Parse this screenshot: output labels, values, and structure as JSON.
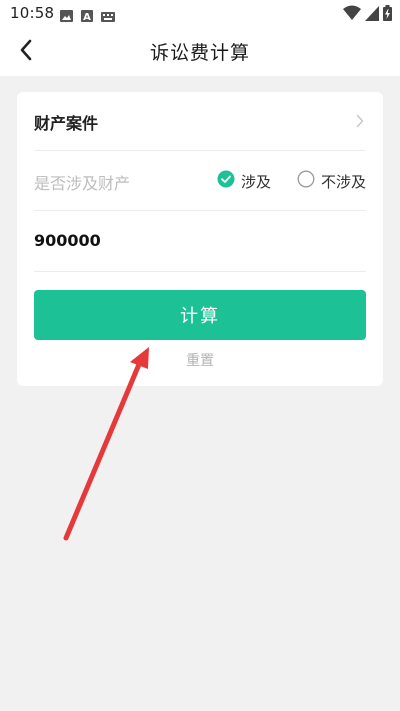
{
  "status_bar": {
    "time": "10:58",
    "left_icons": [
      "image-icon",
      "text-a-icon",
      "keyboard-icon"
    ],
    "right_icons": [
      "wifi-icon",
      "signal-icon",
      "battery-charging-icon"
    ]
  },
  "nav": {
    "back_icon": "chevron-left-icon",
    "title": "诉讼费计算"
  },
  "form": {
    "case_type": {
      "label": "财产案件",
      "icon": "chevron-right-icon"
    },
    "property": {
      "label": "是否涉及财产",
      "options": [
        {
          "label": "涉及",
          "selected": true
        },
        {
          "label": "不涉及",
          "selected": false
        }
      ]
    },
    "amount": {
      "value": "900000"
    },
    "calculate_label": "计算",
    "reset_label": "重置"
  },
  "colors": {
    "accent": "#1dc196",
    "annotation_arrow": "#e5393b",
    "muted_text": "#bdbdbd",
    "background": "#f1f1f1"
  }
}
